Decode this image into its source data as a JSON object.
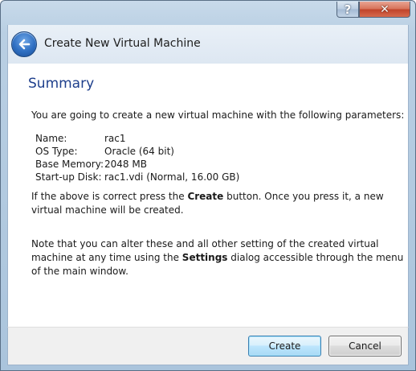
{
  "window": {
    "help_glyph": "?",
    "close_glyph": "✕"
  },
  "header": {
    "title": "Create New Virtual Machine",
    "back_icon": "back-arrow-icon"
  },
  "page": {
    "heading": "Summary",
    "intro": "You are going to create a new virtual machine with the following parameters:",
    "params": [
      {
        "key": "Name:",
        "value": "rac1"
      },
      {
        "key": "OS Type:",
        "value": "Oracle (64 bit)"
      },
      {
        "key": "Base Memory:",
        "value": "2048 MB"
      },
      {
        "key": "Start-up Disk:",
        "value": "rac1.vdi (Normal, 16.00 GB)"
      }
    ],
    "para1": {
      "before": "If the above is correct press the ",
      "bold": "Create",
      "after": " button. Once you press it, a new virtual machine will be created."
    },
    "para2": {
      "before": "Note that you can alter these and all other setting of the created virtual machine at any time using the ",
      "bold": "Settings",
      "after": " dialog accessible through the menu of the main window."
    }
  },
  "footer": {
    "create_label": "Create",
    "cancel_label": "Cancel"
  },
  "colors": {
    "heading": "#1e3f8c",
    "frame": "#b9cfe3",
    "close": "#c0432a"
  }
}
